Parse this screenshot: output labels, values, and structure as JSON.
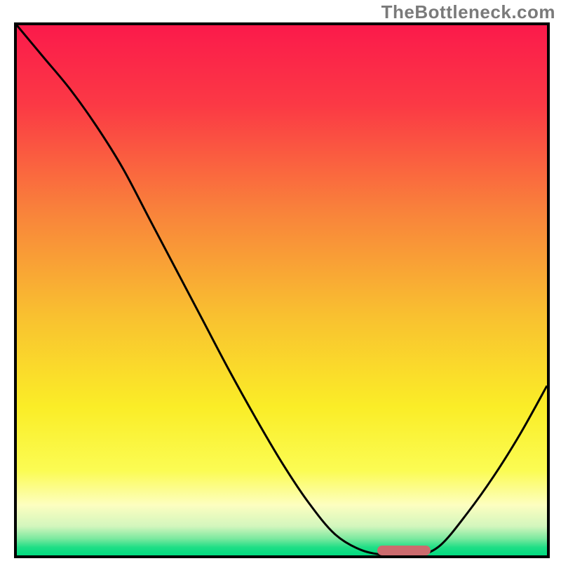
{
  "watermark": "TheBottleneck.com",
  "colors": {
    "border": "#000000",
    "curve": "#000000",
    "sweet_spot": "#cc6b6e",
    "gradient_stops": [
      {
        "offset": 0.0,
        "color": "#fb1a4b"
      },
      {
        "offset": 0.15,
        "color": "#fb3945"
      },
      {
        "offset": 0.35,
        "color": "#f9823b"
      },
      {
        "offset": 0.55,
        "color": "#f9c130"
      },
      {
        "offset": 0.72,
        "color": "#faed27"
      },
      {
        "offset": 0.84,
        "color": "#fbfc53"
      },
      {
        "offset": 0.905,
        "color": "#fdfec0"
      },
      {
        "offset": 0.945,
        "color": "#d3f6bd"
      },
      {
        "offset": 0.968,
        "color": "#7de9a0"
      },
      {
        "offset": 0.985,
        "color": "#1ede86"
      },
      {
        "offset": 1.0,
        "color": "#00db80"
      }
    ]
  },
  "chart_data": {
    "type": "line",
    "title": "",
    "xlabel": "",
    "ylabel": "",
    "xlim": [
      0,
      100
    ],
    "ylim": [
      0,
      100
    ],
    "grid": false,
    "legend": false,
    "x": [
      0,
      5,
      10,
      15,
      20,
      25,
      30,
      35,
      40,
      45,
      50,
      55,
      60,
      65,
      70,
      73,
      76,
      80,
      85,
      90,
      95,
      100
    ],
    "values": [
      100,
      94,
      88,
      81,
      73,
      63.5,
      54,
      44.5,
      35,
      26,
      17.5,
      10,
      4,
      1,
      0,
      0,
      0,
      2,
      8,
      15,
      23,
      32
    ],
    "sweet_spot_range": [
      68,
      78
    ]
  }
}
